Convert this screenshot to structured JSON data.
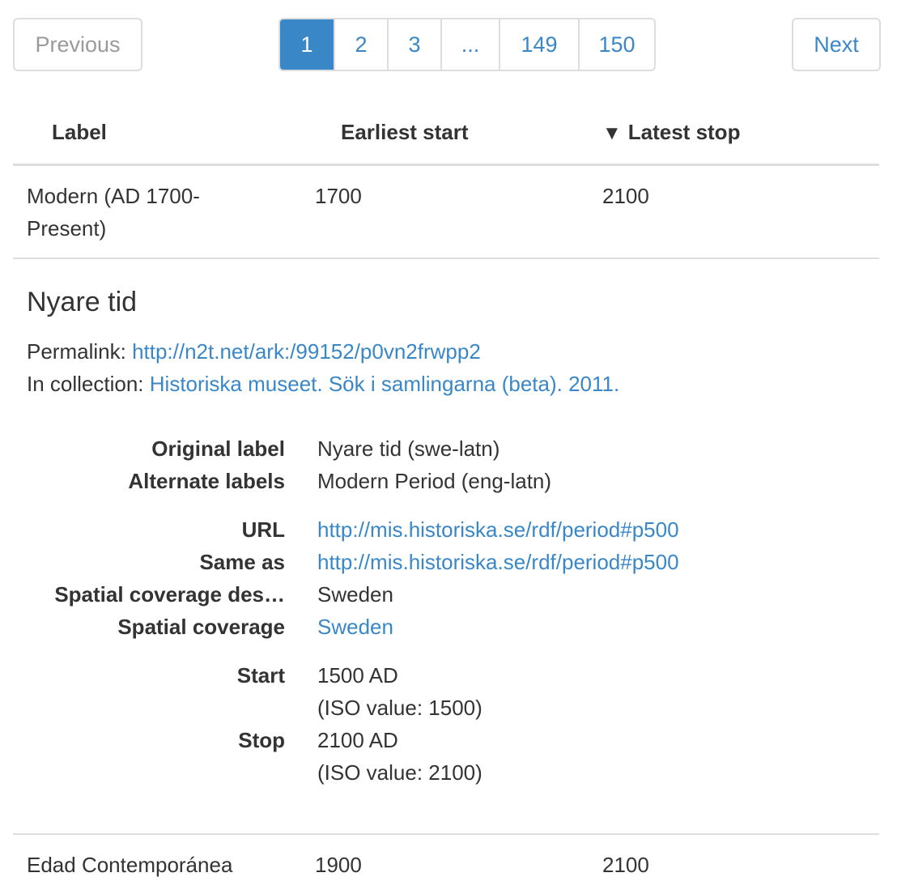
{
  "pagination": {
    "previous": "Previous",
    "next": "Next",
    "pages": [
      "1",
      "2",
      "3",
      "...",
      "149",
      "150"
    ],
    "active_page": "1"
  },
  "table": {
    "headers": {
      "label": "Label",
      "earliest_start": "Earliest start",
      "latest_stop": "Latest stop",
      "sort_icon": "▼"
    },
    "rows": [
      {
        "label": "Modern (AD 1700-Present)",
        "label_line1": "Modern (AD 1700-",
        "label_line2": "Present)",
        "start": "1700",
        "stop": "2100"
      },
      {
        "label": "Edad Contemporánea",
        "start": "1900",
        "stop": "2100"
      }
    ]
  },
  "detail": {
    "title": "Nyare tid",
    "permalink_label": "Permalink:",
    "permalink_url": "http://n2t.net/ark:/99152/p0vn2frwpp2",
    "collection_label": "In collection:",
    "collection_value": "Historiska museet. Sök i samlingarna (beta). 2011.",
    "original_label_key": "Original label",
    "original_label_value": "Nyare tid (swe-latn)",
    "alternate_labels_key": "Alternate labels",
    "alternate_labels_value": "Modern Period (eng-latn)",
    "url_key": "URL",
    "url_value": "http://mis.historiska.se/rdf/period#p500",
    "same_as_key": "Same as",
    "same_as_value": "http://mis.historiska.se/rdf/period#p500",
    "spatial_desc_key": "Spatial coverage des…",
    "spatial_desc_value": "Sweden",
    "spatial_key": "Spatial coverage",
    "spatial_value": "Sweden",
    "start_key": "Start",
    "start_value": "1500 AD",
    "start_iso": "(ISO value: 1500)",
    "stop_key": "Stop",
    "stop_value": "2100 AD",
    "stop_iso": "(ISO value: 2100)"
  },
  "colors": {
    "link": "#3a87c8",
    "border": "#dddddd",
    "text": "#333333",
    "disabled": "#9a9a9a"
  }
}
